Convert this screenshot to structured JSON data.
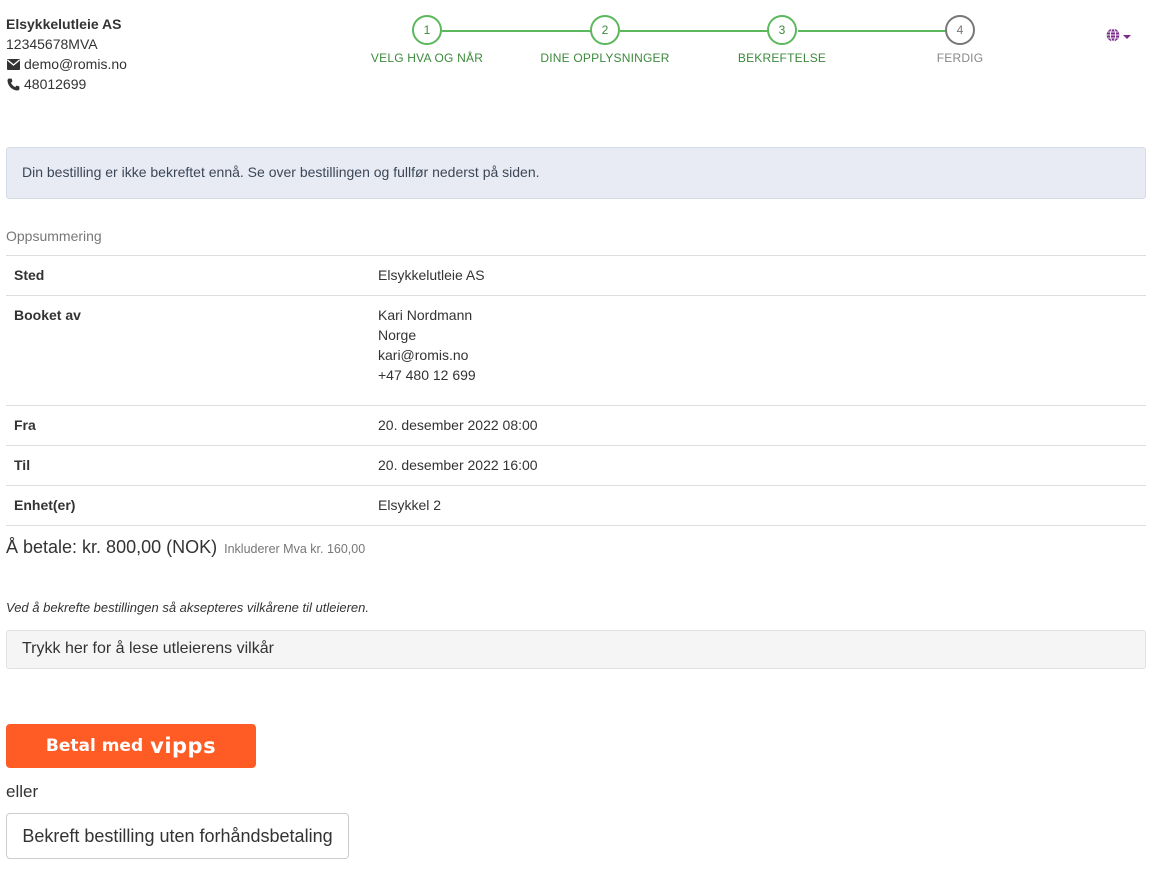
{
  "company": {
    "name": "Elsykkelutleie AS",
    "org_number": "12345678MVA",
    "email": "demo@romis.no",
    "phone": "48012699"
  },
  "stepper": {
    "steps": [
      {
        "number": "1",
        "label": "VELG HVA OG NÅR",
        "state": "done"
      },
      {
        "number": "2",
        "label": "DINE OPPLYSNINGER",
        "state": "done"
      },
      {
        "number": "3",
        "label": "BEKREFTELSE",
        "state": "current"
      },
      {
        "number": "4",
        "label": "FERDIG",
        "state": "pending"
      }
    ],
    "active_color": "#5cb85c",
    "inactive_color": "#777777"
  },
  "language_selector": {
    "icon": "globe-icon",
    "color": "#7b2b8e"
  },
  "alert": {
    "text": "Din bestilling er ikke bekreftet ennå. Se over bestillingen og fullfør nederst på siden."
  },
  "summary": {
    "title": "Oppsummering",
    "rows": {
      "place": {
        "label": "Sted",
        "value": "Elsykkelutleie AS"
      },
      "booked_by": {
        "label": "Booket av",
        "name": "Kari Nordmann",
        "country": "Norge",
        "email": "kari@romis.no",
        "phone": "+47 480 12 699"
      },
      "from": {
        "label": "Fra",
        "value": "20. desember 2022 08:00"
      },
      "to": {
        "label": "Til",
        "value": "20. desember 2022 16:00"
      },
      "units": {
        "label": "Enhet(er)",
        "value": "Elsykkel 2"
      }
    }
  },
  "payment": {
    "amount_text": "Å betale: kr. 800,00 (NOK)",
    "vat_text": "Inkluderer Mva kr. 160,00"
  },
  "terms": {
    "note": "Ved å bekrefte bestillingen så aksepteres vilkårene til utleieren.",
    "link_text": "Trykk her for å lese utleierens vilkår"
  },
  "actions": {
    "vipps_label": "Betal med",
    "vipps_logo": "vipps",
    "vipps_color": "#ff5b24",
    "or_text": "eller",
    "confirm_label": "Bekreft bestilling uten forhåndsbetaling"
  }
}
